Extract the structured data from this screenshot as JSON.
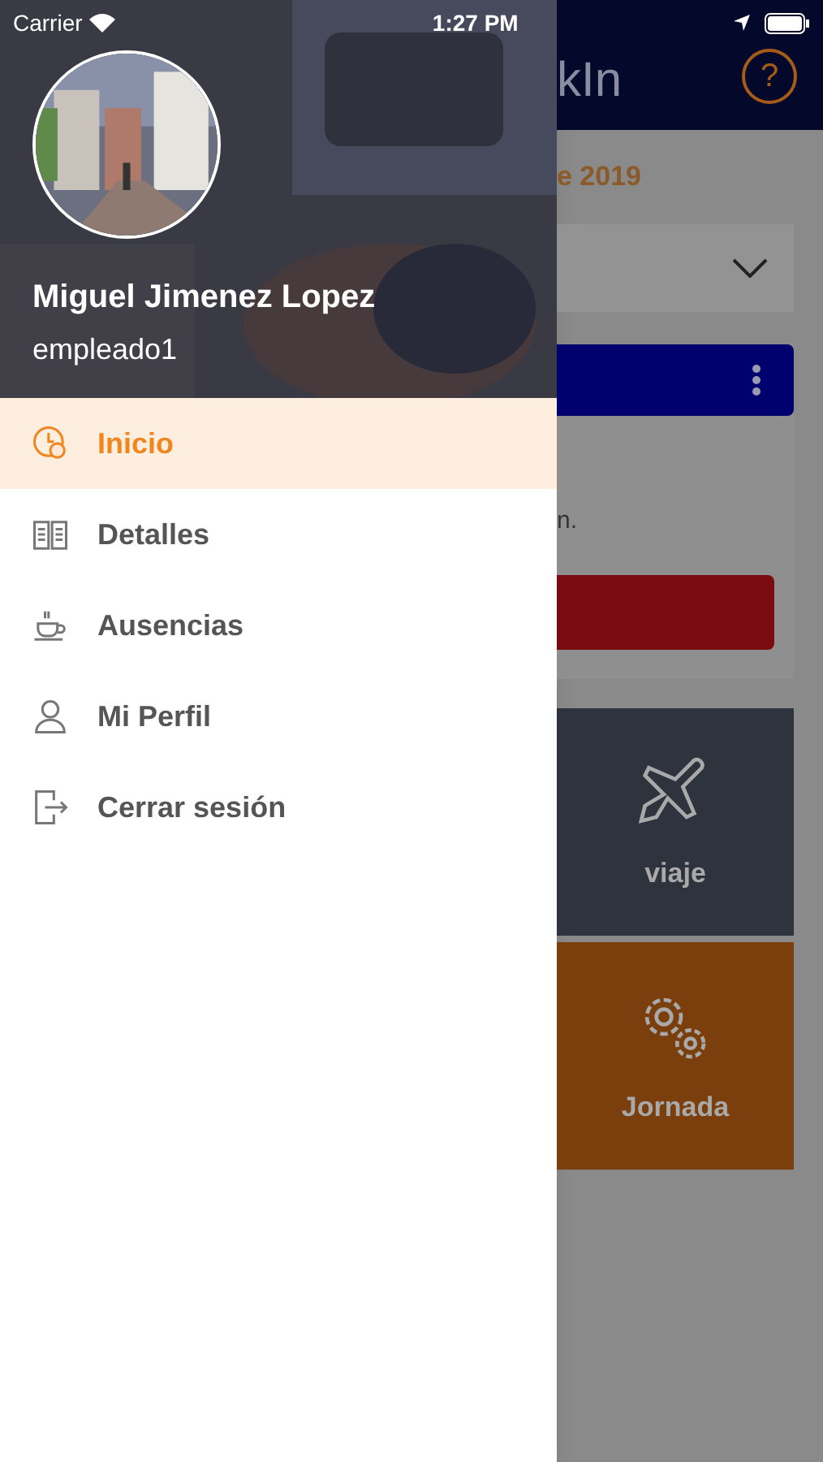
{
  "status_bar": {
    "carrier": "Carrier",
    "time": "1:27 PM"
  },
  "profile": {
    "name": "Miguel Jimenez Lopez",
    "username": "empleado1"
  },
  "menu": [
    {
      "label": "Inicio",
      "selected": true,
      "kind": "clock"
    },
    {
      "label": "Detalles",
      "selected": false,
      "kind": "book"
    },
    {
      "label": "Ausencias",
      "selected": false,
      "kind": "cup"
    },
    {
      "label": "Mi Perfil",
      "selected": false,
      "kind": "user"
    },
    {
      "label": "Cerrar sesión",
      "selected": false,
      "kind": "logout"
    }
  ],
  "background": {
    "title": "kIn",
    "help": "?",
    "date": "e 2019",
    "note": "n.",
    "tiles": [
      {
        "label": "viaje",
        "kind": "plane"
      },
      {
        "label": "Jornada",
        "kind": "gears"
      }
    ]
  }
}
